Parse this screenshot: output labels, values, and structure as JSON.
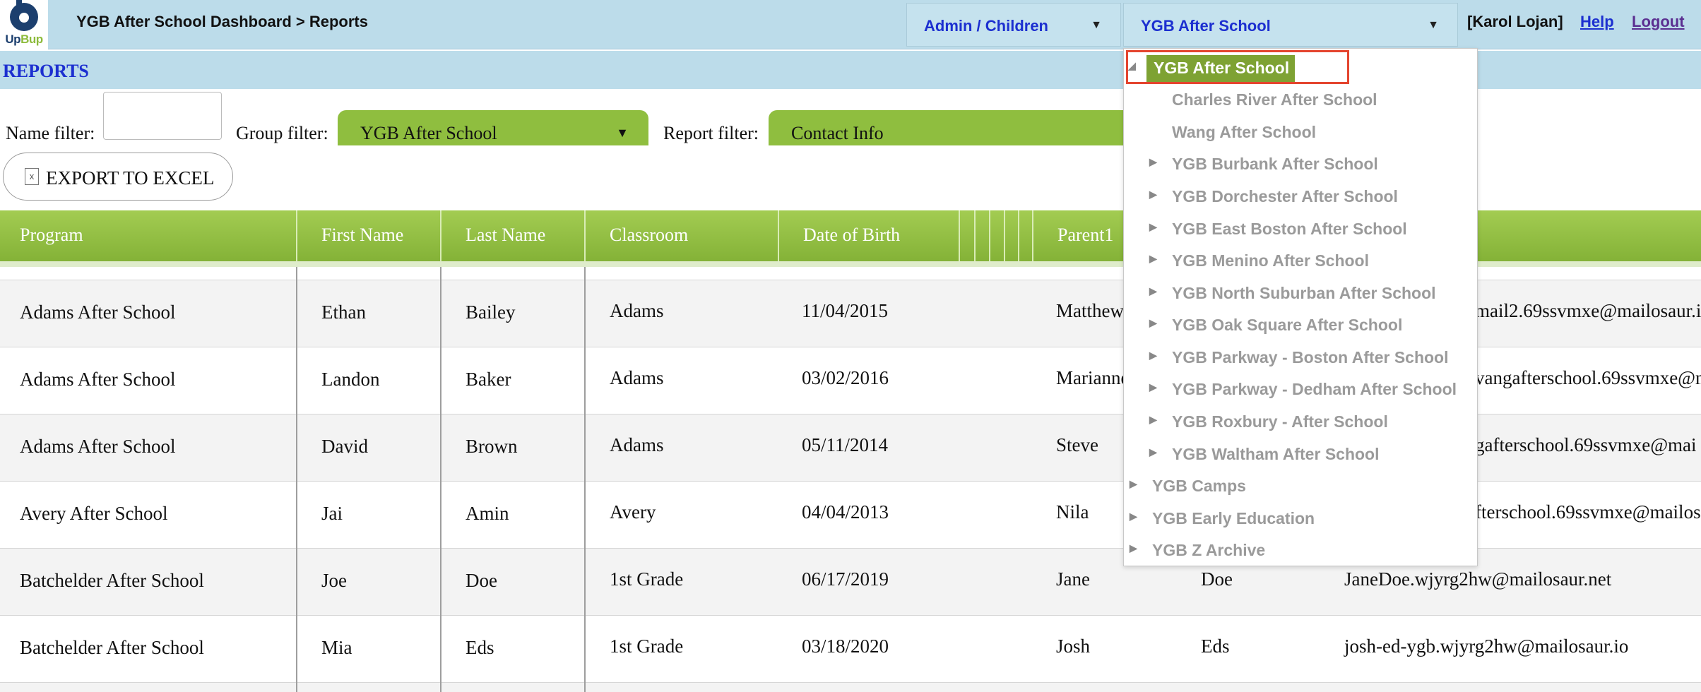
{
  "header": {
    "logo_text_a": "Up",
    "logo_text_b": "Bup",
    "breadcrumb": "YGB After School Dashboard > Reports",
    "admin_dropdown": "Admin / Children",
    "school_dropdown": "YGB After School",
    "user": "[Karol Lojan]",
    "help": "Help",
    "logout": "Logout"
  },
  "page": {
    "title": "REPORTS"
  },
  "filters": {
    "name_label": "Name filter:",
    "name_value": "",
    "group_label": "Group filter:",
    "group_value": "YGB After School",
    "report_label": "Report filter:",
    "report_value": "Contact Info"
  },
  "export": {
    "label": "EXPORT TO EXCEL",
    "icon_glyph": "x"
  },
  "table": {
    "headers": [
      "Program",
      "First Name",
      "Last Name",
      "Classroom",
      "Date of Birth",
      "Parent1"
    ],
    "rows": [
      [
        "Adams After School",
        "Ethan",
        "Bailey",
        "Adams",
        "11/04/2015",
        "Matthew",
        "",
        "mail2.69ssvmxe@mailosaur.i"
      ],
      [
        "Adams After School",
        "Landon",
        "Baker",
        "Adams",
        "03/02/2016",
        "Marianne",
        "",
        "vangafterschool.69ssvmxe@m"
      ],
      [
        "Adams After School",
        "David",
        "Brown",
        "Adams",
        "05/11/2014",
        "Steve",
        "",
        "gafterschool.69ssvmxe@mai"
      ],
      [
        "Avery After School",
        "Jai",
        "Amin",
        "Avery",
        "04/04/2013",
        "Nila",
        "",
        "fterschool.69ssvmxe@mailos"
      ],
      [
        "Batchelder After School",
        "Joe",
        "Doe",
        "1st Grade",
        "06/17/2019",
        "Jane",
        "Doe",
        "JaneDoe.wjyrg2hw@mailosaur.net"
      ],
      [
        "Batchelder After School",
        "Mia",
        "Eds",
        "1st Grade",
        "03/18/2020",
        "Josh",
        "Eds",
        "josh-ed-ygb.wjyrg2hw@mailosaur.io"
      ]
    ]
  },
  "tree": {
    "items": [
      {
        "label": "YGB After School",
        "level": 0,
        "arrow": "◢",
        "selected": true
      },
      {
        "label": "Charles River After School",
        "level": 1,
        "arrow": ""
      },
      {
        "label": "Wang After School",
        "level": 1,
        "arrow": ""
      },
      {
        "label": "YGB Burbank After School",
        "level": 1,
        "arrow": "▶"
      },
      {
        "label": "YGB Dorchester After School",
        "level": 1,
        "arrow": "▶"
      },
      {
        "label": "YGB East Boston After School",
        "level": 1,
        "arrow": "▶"
      },
      {
        "label": "YGB Menino After School",
        "level": 1,
        "arrow": "▶"
      },
      {
        "label": "YGB North Suburban After School",
        "level": 1,
        "arrow": "▶"
      },
      {
        "label": "YGB Oak Square After School",
        "level": 1,
        "arrow": "▶"
      },
      {
        "label": "YGB Parkway - Boston After School",
        "level": 1,
        "arrow": "▶"
      },
      {
        "label": "YGB Parkway - Dedham After School",
        "level": 1,
        "arrow": "▶"
      },
      {
        "label": "YGB Roxbury - After School",
        "level": 1,
        "arrow": "▶"
      },
      {
        "label": "YGB Waltham After School",
        "level": 1,
        "arrow": "▶"
      },
      {
        "label": "YGB Camps",
        "level": 0,
        "arrow": "▶"
      },
      {
        "label": "YGB Early Education",
        "level": 0,
        "arrow": "▶"
      },
      {
        "label": "YGB Z Archive",
        "level": 0,
        "arrow": "▶"
      }
    ]
  },
  "colors": {
    "topbar": "#bcdcea",
    "accent_green": "#8fbe3f",
    "selected_green": "#7ea233",
    "link_blue": "#1c2fd0",
    "highlight_red": "#e4452f"
  }
}
